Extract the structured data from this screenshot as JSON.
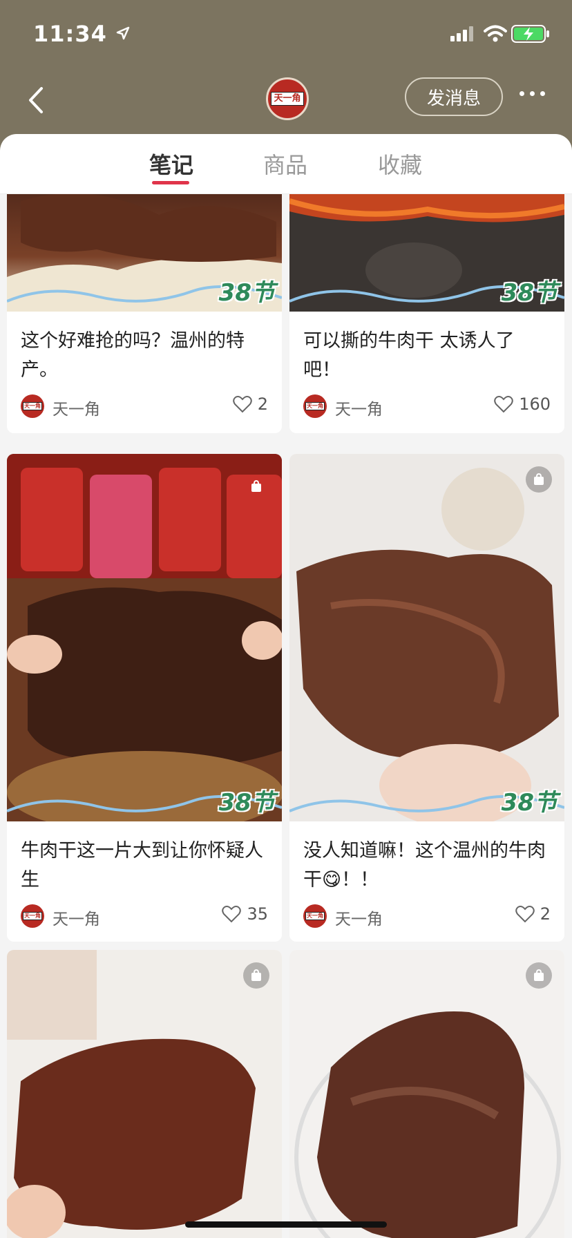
{
  "status_bar": {
    "time": "11:34"
  },
  "header": {
    "shop_logo_text": "天一角",
    "message_button": "发消息"
  },
  "tabs": [
    {
      "label": "笔记",
      "active": true
    },
    {
      "label": "商品",
      "active": false
    },
    {
      "label": "收藏",
      "active": false
    }
  ],
  "badge_text": "38节",
  "posts": [
    {
      "title": "这个好难抢的吗？温州的特产。",
      "author": "天一角",
      "likes": "2"
    },
    {
      "title": "可以撕的牛肉干 太诱人了吧！",
      "author": "天一角",
      "likes": "160"
    },
    {
      "title": "牛肉干这一片大到让你怀疑人生",
      "author": "天一角",
      "likes": "35"
    },
    {
      "title": "没人知道嘛！这个温州的牛肉干😋！！",
      "author": "天一角",
      "likes": "2"
    }
  ],
  "colors": {
    "header_bg": "#7c7460",
    "accent": "#e0344a",
    "brand": "#b82a22"
  }
}
